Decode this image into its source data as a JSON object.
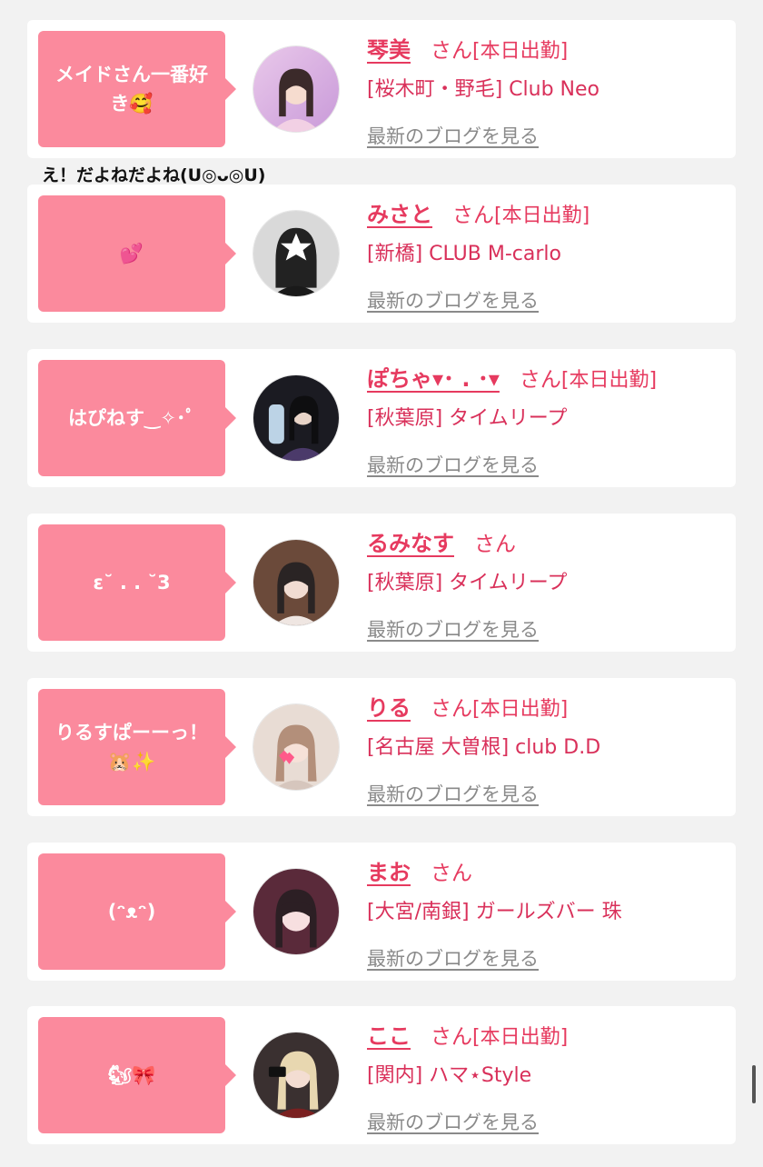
{
  "common": {
    "san": "さん",
    "blog_link": "最新のブログを見る"
  },
  "entries": [
    {
      "message": "メイドさん一番好き🥰",
      "name": "琴美",
      "shift": "[本日出勤]",
      "shop": "[桜木町・野毛] Club Neo"
    },
    {
      "message": "💕",
      "name": "みさと",
      "shift": "[本日出勤]",
      "shop": "[新橋] CLUB M-carlo"
    },
    {
      "message": "はぴねす‿✧･ﾟ",
      "name": "ぽちゃ▾･ . ･▾",
      "shift": "[本日出勤]",
      "shop": "[秋葉原] タイムリープ"
    },
    {
      "message": "ε˘ . . ˘3",
      "name": "るみなす",
      "shift": "",
      "shop": "[秋葉原] タイムリープ"
    },
    {
      "message": "りるすぱーーっ！🐹✨",
      "name": "りる",
      "shift": "[本日出勤]",
      "shop": "[名古屋 大曽根] club D.D"
    },
    {
      "message": "(ᵔᴥᵔ)",
      "name": "まお",
      "shift": "",
      "shop": "[大宮/南銀] ガールズバー 珠"
    },
    {
      "message": "🐿🎀",
      "name": "ここ",
      "shift": "[本日出勤]",
      "shop": "[関内] ハマ⋆Style"
    }
  ],
  "comment": "え！だよねだよね(U◎ᴗ◎U)"
}
